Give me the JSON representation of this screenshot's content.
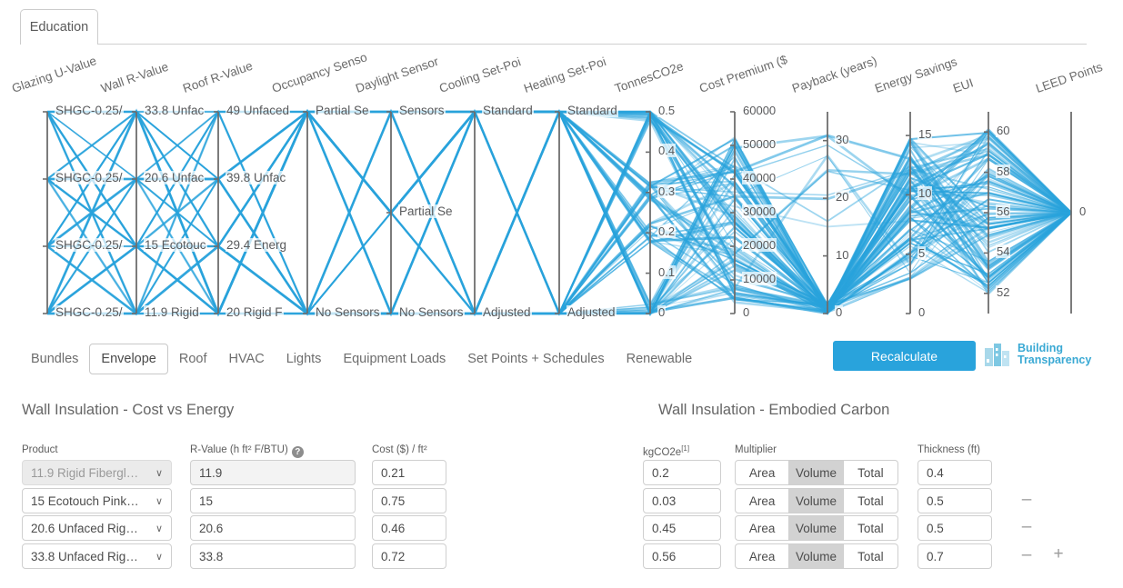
{
  "top_tab": {
    "label": "Education"
  },
  "chart_data": {
    "type": "parallel-coordinates",
    "title": "",
    "line_color": "#29a3dc",
    "axis_color": "#6d6d6d",
    "axes": [
      {
        "name": "Glazing U-Value",
        "kind": "categorical",
        "ticks": [
          "SHGC-0.25/",
          "SHGC-0.25/",
          "SHGC-0.25/",
          "SHGC-0.25/"
        ]
      },
      {
        "name": "Wall R-Value",
        "kind": "categorical",
        "ticks": [
          "33.8 Unfac",
          "20.6 Unfac",
          "15 Ecotouc",
          "11.9 Rigid"
        ]
      },
      {
        "name": "Roof R-Value",
        "kind": "categorical",
        "ticks": [
          "49 Unfaced",
          "39.8 Unfac",
          "29.4 Energ",
          "20 Rigid F"
        ]
      },
      {
        "name": "Occupancy Senso",
        "kind": "categorical",
        "ticks": [
          "Partial Se",
          "No Sensors"
        ]
      },
      {
        "name": "Daylight Sensor",
        "kind": "categorical",
        "ticks": [
          "Sensors",
          "Partial Se",
          "No Sensors"
        ]
      },
      {
        "name": "Cooling Set-Poi",
        "kind": "categorical",
        "ticks": [
          "Standard",
          "Adjusted"
        ]
      },
      {
        "name": "Heating Set-Poi",
        "kind": "categorical",
        "ticks": [
          "Standard",
          "Adjusted"
        ]
      },
      {
        "name": "TonnesCO2e",
        "kind": "numeric",
        "range": [
          0,
          0.5
        ],
        "ticks": [
          "0.5",
          "0.4",
          "0.3",
          "0.2",
          "0.1",
          "0"
        ]
      },
      {
        "name": "Cost Premium ($",
        "kind": "numeric",
        "range": [
          0,
          60000
        ],
        "ticks": [
          "60000",
          "50000",
          "40000",
          "30000",
          "20000",
          "10000",
          "0"
        ]
      },
      {
        "name": "Payback (years)",
        "kind": "numeric",
        "range": [
          0,
          35
        ],
        "ticks": [
          "30",
          "20",
          "10",
          "0"
        ]
      },
      {
        "name": "Energy Savings",
        "kind": "numeric",
        "range": [
          0,
          17
        ],
        "ticks": [
          "15",
          "10",
          "5",
          "0"
        ]
      },
      {
        "name": "EUI",
        "kind": "numeric",
        "range": [
          51,
          61
        ],
        "ticks": [
          "60",
          "58",
          "56",
          "54",
          "52"
        ]
      },
      {
        "name": "LEED Points",
        "kind": "numeric",
        "range": [
          0,
          0
        ],
        "ticks": [
          "0"
        ]
      }
    ]
  },
  "subtabs": {
    "items": [
      {
        "label": "Bundles",
        "active": false
      },
      {
        "label": "Envelope",
        "active": true
      },
      {
        "label": "Roof",
        "active": false
      },
      {
        "label": "HVAC",
        "active": false
      },
      {
        "label": "Lights",
        "active": false
      },
      {
        "label": "Equipment Loads",
        "active": false
      },
      {
        "label": "Set Points + Schedules",
        "active": false
      },
      {
        "label": "Renewable",
        "active": false
      }
    ]
  },
  "recalculate_label": "Recalculate",
  "logo": {
    "line1": "Building",
    "line2": "Transparency",
    "color": "#3aa9d4"
  },
  "left_panel": {
    "title": "Wall Insulation - Cost vs Energy",
    "columns": {
      "product": "Product",
      "rvalue": "R-Value (h ft² F/BTU)",
      "cost": "Cost ($) / ft²"
    },
    "rows": [
      {
        "product": "11.9 Rigid Fibergl…",
        "rvalue": "11.9",
        "cost": "0.21",
        "disabled": true
      },
      {
        "product": "15 Ecotouch Pink…",
        "rvalue": "15",
        "cost": "0.75",
        "disabled": false
      },
      {
        "product": "20.6 Unfaced Rig…",
        "rvalue": "20.6",
        "cost": "0.46",
        "disabled": false
      },
      {
        "product": "33.8 Unfaced Rig…",
        "rvalue": "33.8",
        "cost": "0.72",
        "disabled": false
      }
    ]
  },
  "right_panel": {
    "title": "Wall Insulation - Embodied Carbon",
    "columns": {
      "kgco2e": "kgCO2e",
      "kgco2e_note": "[1]",
      "multiplier": "Multiplier",
      "thickness": "Thickness (ft)"
    },
    "multiplier_options": [
      "Area",
      "Volume",
      "Total"
    ],
    "rows": [
      {
        "kgco2e": "0.2",
        "multiplier": "Volume",
        "thickness": "0.4",
        "minus": false,
        "plus": false
      },
      {
        "kgco2e": "0.03",
        "multiplier": "Volume",
        "thickness": "0.5",
        "minus": true,
        "plus": false
      },
      {
        "kgco2e": "0.45",
        "multiplier": "Volume",
        "thickness": "0.5",
        "minus": true,
        "plus": false
      },
      {
        "kgco2e": "0.56",
        "multiplier": "Volume",
        "thickness": "0.7",
        "minus": true,
        "plus": true
      }
    ],
    "minus_label": "–",
    "plus_label": "+"
  }
}
